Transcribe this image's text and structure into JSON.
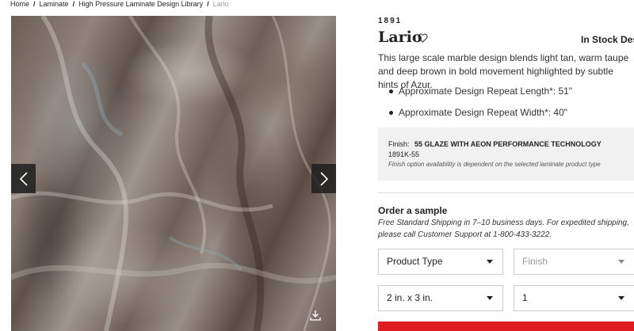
{
  "breadcrumb": {
    "items": [
      "Home",
      "Laminate",
      "High Pressure Laminate Design Library"
    ],
    "current": "Lario"
  },
  "product": {
    "design_number": "1891",
    "title": "Lario",
    "stock_status": "In Stock Design",
    "description": "This large scale marble design blends light tan, warm taupe and deep brown in bold movement highlighted by subtle hints of Azur.",
    "specs": [
      "Approximate Design Repeat Length*: 51\"",
      "Approximate Design Repeat Width*: 40\""
    ]
  },
  "finish": {
    "label": "Finish:",
    "value": "55 GLAZE  WITH AEON PERFORMANCE TECHNOLOGY",
    "code": "1891K-55",
    "note": "Finish option availability is dependent on the selected laminate product type"
  },
  "sample": {
    "heading": "Order a sample",
    "shipping_note": "Free Standard Shipping in 7–10 business days. For expedited shipping, please call Customer Support at 1-800-433-3222.",
    "product_type": "Product Type",
    "finish": "Finish",
    "size": "2 in. x 3 in.",
    "quantity": "1"
  },
  "icons": {
    "prev": "chevron-left-icon",
    "next": "chevron-right-icon",
    "favorite": "heart-icon",
    "download": "download-icon"
  },
  "colors": {
    "accent": "#e01b22",
    "finish_box": "#f1f1f1"
  }
}
